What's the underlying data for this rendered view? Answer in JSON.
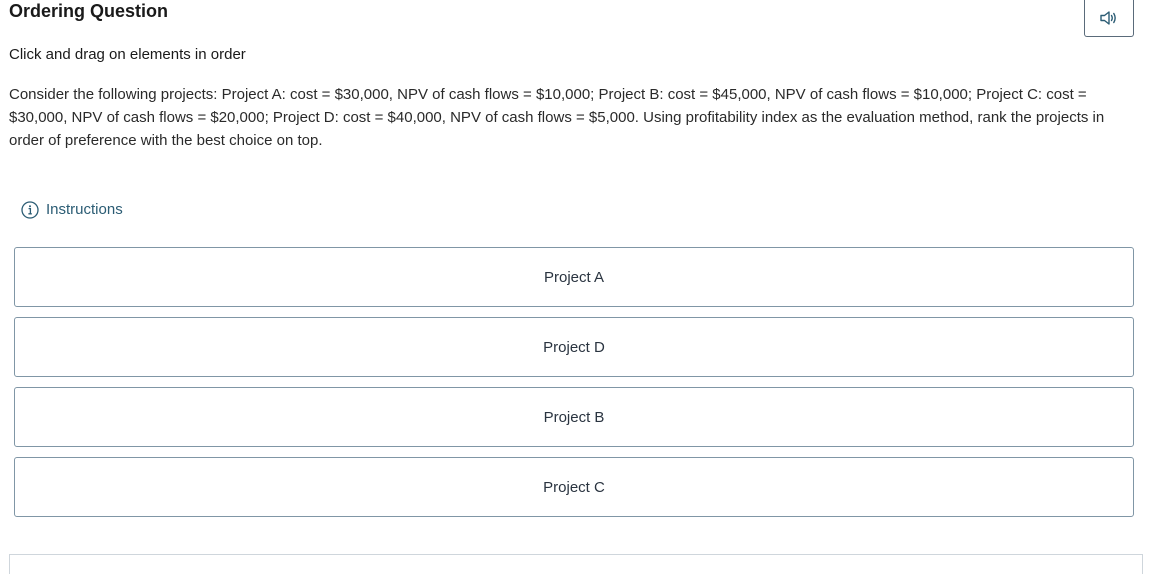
{
  "header": {
    "title": "Ordering Question"
  },
  "subtitle": "Click and drag on elements in order",
  "prompt": "Consider the following projects: Project A: cost = $30,000, NPV of cash flows = $10,000; Project B: cost = $45,000, NPV of cash flows = $10,000; Project C: cost = $30,000, NPV of cash flows = $20,000; Project D: cost = $40,000, NPV of cash flows = $5,000. Using profitability index as the evaluation method, rank the projects in order of preference with the best choice on top.",
  "instructions": {
    "label": "Instructions",
    "icon": "info-icon"
  },
  "audio": {
    "icon": "speaker-icon"
  },
  "items": [
    {
      "label": "Project A"
    },
    {
      "label": "Project D"
    },
    {
      "label": "Project B"
    },
    {
      "label": "Project C"
    }
  ],
  "colors": {
    "accent": "#2b5c74",
    "border": "#8096a6"
  }
}
